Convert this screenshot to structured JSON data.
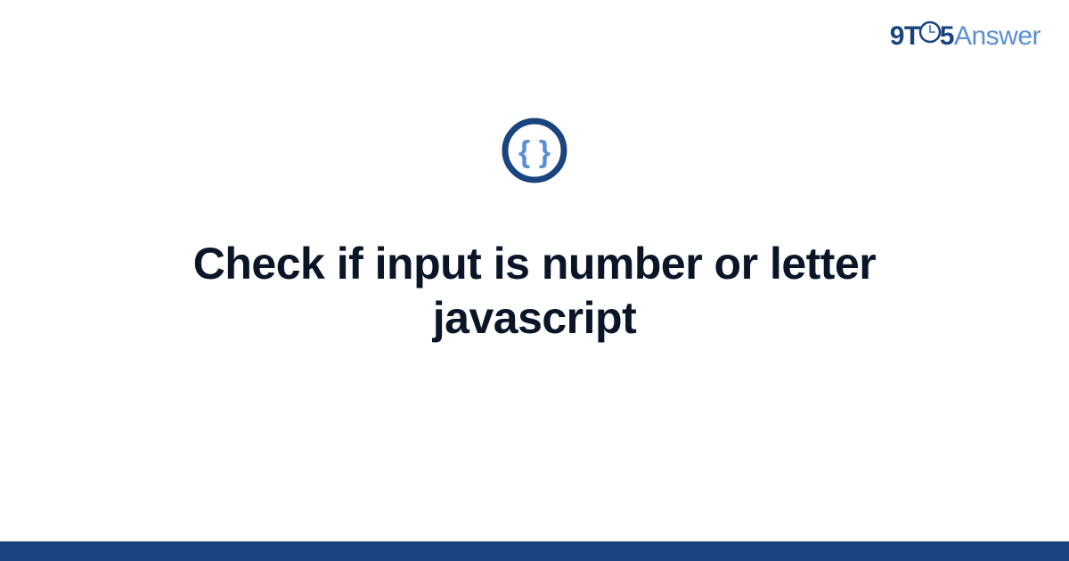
{
  "logo": {
    "part1": "9T",
    "part2": "5",
    "part3": "Answer"
  },
  "icon": {
    "name": "code-braces-icon",
    "braces": "{ }"
  },
  "title": "Check if input is number or letter javascript",
  "colors": {
    "dark_blue": "#1a4480",
    "light_blue": "#5a8fd4",
    "text": "#0a1628"
  }
}
